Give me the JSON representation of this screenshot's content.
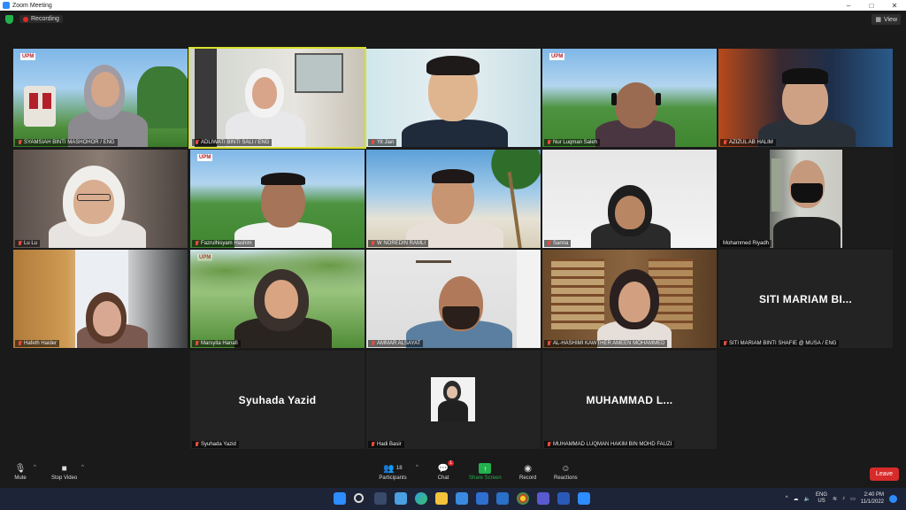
{
  "window": {
    "title": "Zoom Meeting",
    "minimize": "–",
    "maximize": "□",
    "close": "✕"
  },
  "topbar": {
    "recording_label": "Recording",
    "view_label": "View"
  },
  "participants": [
    {
      "name": "SYAMSIAH BINTI MASHOHOR / ENG",
      "muted": true
    },
    {
      "name": "ADLIWATI BINTI SALI / ENG",
      "muted": true
    },
    {
      "name": "Yit Jian",
      "muted": true
    },
    {
      "name": "Nur Luqman Saleh",
      "muted": true
    },
    {
      "name": "AZIZUL AB HALIM",
      "muted": true
    },
    {
      "name": "Lu Lu",
      "muted": true
    },
    {
      "name": "Fazrulhisyam Hashim",
      "muted": true
    },
    {
      "name": "W NOREDIN RAMLI",
      "muted": true
    },
    {
      "name": "Sanna",
      "muted": true
    },
    {
      "name": "Mohammed Riyadh",
      "muted": false
    },
    {
      "name": "Hafeth Haider",
      "muted": true
    },
    {
      "name": "Marsyita Hanafi",
      "muted": true
    },
    {
      "name": "AMMAR ALSAYAT",
      "muted": true
    },
    {
      "name": "AL-HASHIMI KAWTHER AMEEN MOHAMMED",
      "muted": true
    },
    {
      "name": "SITI MARIAM BINTI SHAFIE @ MUSA / ENG",
      "muted": true,
      "display": "SITI MARIAM BI..."
    },
    {
      "name": "Syuhada Yazid",
      "muted": true,
      "display": "Syuhada Yazid"
    },
    {
      "name": "Hadi Basir",
      "muted": true
    },
    {
      "name": "MUHAMMAD LUQMAN HAKIM BIN MOHD FAUZI",
      "muted": true,
      "display": "MUHAMMAD L..."
    }
  ],
  "logo_text": "UPM",
  "toolbar": {
    "mute": "Mute",
    "stop_video": "Stop Video",
    "participants": "Participants",
    "participants_count": "18",
    "chat": "Chat",
    "chat_badge": "1",
    "share_screen": "Share Screen",
    "record": "Record",
    "reactions": "Reactions",
    "leave": "Leave"
  },
  "taskbar": {
    "lang_top": "ENG",
    "lang_bottom": "US",
    "time": "2:40 PM",
    "date": "11/1/2022"
  },
  "colors": {
    "accent": "#2d8cff",
    "active_speaker": "#d8e12a",
    "share": "#22b14c",
    "leave": "#d72b2b"
  }
}
